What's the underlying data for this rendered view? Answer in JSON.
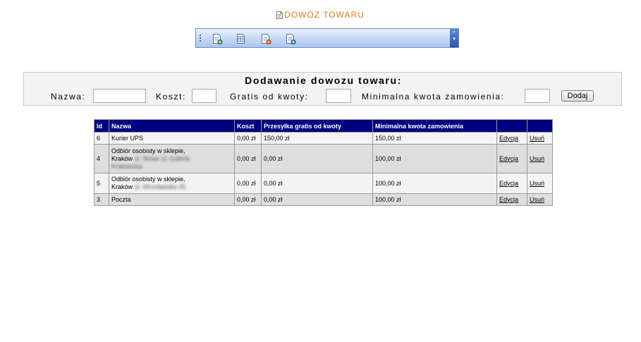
{
  "page": {
    "title": "DOWÓZ TOWARU",
    "icons": [
      "document-icon",
      "add-page-icon",
      "page-list-icon",
      "delete-page-icon",
      "download-page-icon"
    ]
  },
  "form": {
    "heading": "Dodawanie dowozu towaru:",
    "name_label": "Nazwa:",
    "name_value": "",
    "cost_label": "Koszt:",
    "cost_value": "",
    "free_label": "Gratis od kwoty:",
    "free_value": "",
    "min_label": "Minimalna kwota zamowienia:",
    "min_value": "",
    "add_button": "Dodaj"
  },
  "table": {
    "headers": [
      "Id",
      "Nazwa",
      "Koszt",
      "Przesyłka gratis od kwoty",
      "Minimalna kwota zamowienia",
      "",
      ""
    ],
    "rows": [
      {
        "id": "6",
        "name_line1": "Kurier UPS",
        "name_line2": "",
        "name_blur1": "",
        "name_blur2": "",
        "cost": "0,00 zł",
        "free": "150,00 zł",
        "min": "150,00 zł",
        "edit": "Edycja",
        "delete": "Usuń"
      },
      {
        "id": "4",
        "name_line1": "Odbiór osobisty w sklepie,",
        "name_line2": "Kraków",
        "name_blur1": "ul. Nowa 11 Galeria",
        "name_blur2": "Krakowska",
        "cost": "0,00 zł",
        "free": "0,00 zł",
        "min": "100,00 zł",
        "edit": "Edycja",
        "delete": "Usuń"
      },
      {
        "id": "5",
        "name_line1": "Odbiór osobisty w sklepie,",
        "name_line2": "Kraków",
        "name_blur1": "ul. Wrocławska 45",
        "name_blur2": "",
        "cost": "0,00 zł",
        "free": "0,00 zł",
        "min": "100,00 zł",
        "edit": "Edycja",
        "delete": "Usuń"
      },
      {
        "id": "3",
        "name_line1": "Poczta",
        "name_line2": "",
        "name_blur1": "",
        "name_blur2": "",
        "cost": "0,00 zł",
        "free": "0,00 zł",
        "min": "100,00 zł",
        "edit": "Edycja",
        "delete": "Usuń"
      }
    ]
  }
}
